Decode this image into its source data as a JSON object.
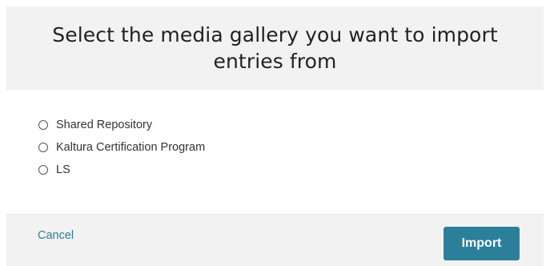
{
  "dialog": {
    "title": "Select the media gallery you want to import entries from"
  },
  "options": [
    {
      "label": "Shared Repository",
      "selected": false
    },
    {
      "label": "Kaltura Certification Program",
      "selected": false
    },
    {
      "label": "LS",
      "selected": false
    }
  ],
  "footer": {
    "cancel_label": "Cancel",
    "import_label": "Import"
  },
  "colors": {
    "accent": "#2b7f9a",
    "link": "#2f7d9a",
    "panel_background": "#f2f2f2"
  }
}
